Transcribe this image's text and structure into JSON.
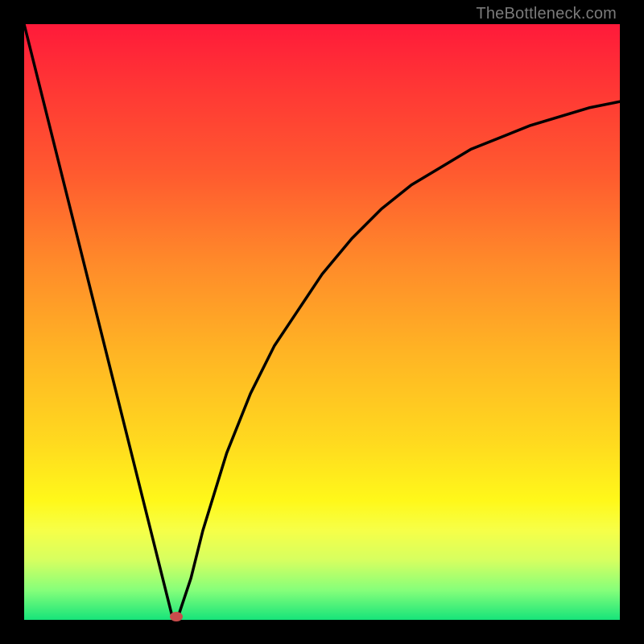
{
  "watermark": "TheBottleneck.com",
  "colors": {
    "frame": "#000000",
    "gradient_top": "#ff1a3a",
    "gradient_bottom": "#16e47a",
    "curve": "#000000",
    "marker": "#c94c4c"
  },
  "chart_data": {
    "type": "line",
    "title": "",
    "xlabel": "",
    "ylabel": "",
    "xlim": [
      0,
      100
    ],
    "ylim": [
      0,
      100
    ],
    "legend": false,
    "grid": false,
    "annotations": [
      {
        "text": "TheBottleneck.com",
        "position": "top-right"
      }
    ],
    "series": [
      {
        "name": "bottleneck-curve",
        "x": [
          0,
          4,
          8,
          12,
          16,
          20,
          24,
          25,
          26,
          28,
          30,
          34,
          38,
          42,
          46,
          50,
          55,
          60,
          65,
          70,
          75,
          80,
          85,
          90,
          95,
          100
        ],
        "values": [
          100,
          84,
          68,
          52,
          36,
          20,
          4,
          0,
          1,
          7,
          15,
          28,
          38,
          46,
          52,
          58,
          64,
          69,
          73,
          76,
          79,
          81,
          83,
          84.5,
          86,
          87
        ]
      }
    ],
    "marker": {
      "x": 25.5,
      "y": 0.5
    }
  }
}
